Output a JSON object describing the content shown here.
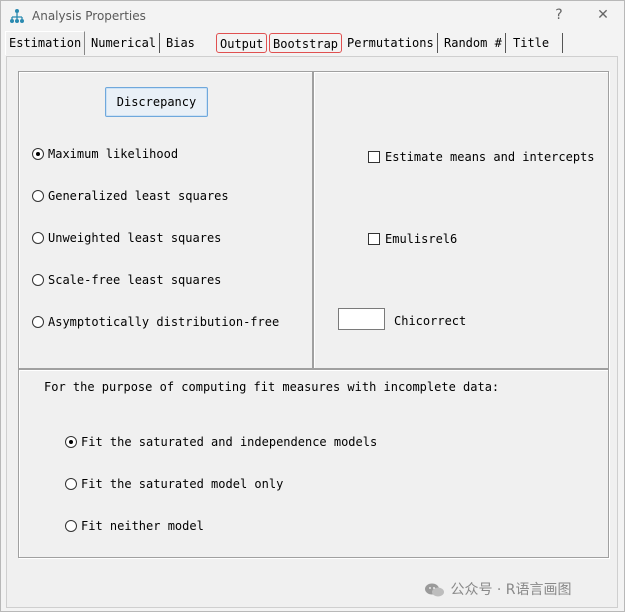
{
  "window": {
    "title": "Analysis Properties",
    "help_button": "?",
    "close_button": "✕"
  },
  "tabs": [
    {
      "label": "Estimation",
      "active": true
    },
    {
      "label": "Numerical"
    },
    {
      "label": "Bias"
    },
    {
      "label": "Output",
      "highlighted": true
    },
    {
      "label": "Bootstrap",
      "highlighted": true
    },
    {
      "label": "Permutations"
    },
    {
      "label": "Random #"
    },
    {
      "label": "Title"
    }
  ],
  "discrepancy": {
    "button_label": "Discrepancy",
    "options": [
      {
        "label": "Maximum likelihood",
        "selected": true
      },
      {
        "label": "Generalized least squares",
        "selected": false
      },
      {
        "label": "Unweighted least squares",
        "selected": false
      },
      {
        "label": "Scale-free least squares",
        "selected": false
      },
      {
        "label": "Asymptotically distribution-free",
        "selected": false
      }
    ]
  },
  "options": {
    "estimate_means": {
      "label": "Estimate means and intercepts",
      "checked": false
    },
    "emulisrel6": {
      "label": "Emulisrel6",
      "checked": false
    },
    "chicorrect": {
      "label": "Chicorrect",
      "value": ""
    }
  },
  "incomplete_data": {
    "heading": "For the purpose of computing fit measures with incomplete data:",
    "options": [
      {
        "label": "Fit the saturated and independence models",
        "selected": true
      },
      {
        "label": "Fit the saturated model only",
        "selected": false
      },
      {
        "label": "Fit neither model",
        "selected": false
      }
    ]
  },
  "watermark": {
    "text": "公众号 · R语言画图"
  },
  "icons": {
    "app": "hierarchy-tree-icon",
    "watermark": "wechat-icon"
  },
  "colors": {
    "tab_highlight": "#e05050",
    "button_border": "#6fa8dc",
    "app_icon": "#2a8ab0"
  }
}
